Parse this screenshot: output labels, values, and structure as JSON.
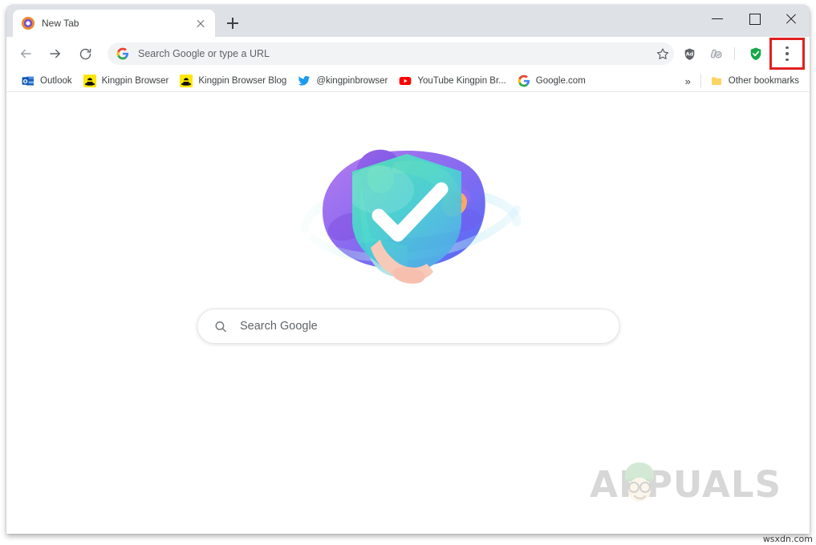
{
  "window": {
    "controls": {
      "minimize": "minimize-button",
      "maximize": "maximize-button",
      "close": "close-button"
    }
  },
  "tabstrip": {
    "tabs": [
      {
        "title": "New Tab",
        "favicon": "kingpin-browser-icon",
        "close_label": "close-tab-icon"
      }
    ],
    "new_tab_label": "+"
  },
  "toolbar": {
    "back_icon": "back-arrow-icon",
    "forward_icon": "forward-arrow-icon",
    "reload_icon": "reload-icon",
    "omnibox": {
      "placeholder": "Search Google or type a URL",
      "value": "",
      "leading_icon": "google-g-icon",
      "star_icon": "bookmark-star-icon"
    },
    "extensions": [
      {
        "name": "adblock-extension-icon"
      },
      {
        "name": "privacy-badger-extension-icon"
      }
    ],
    "shield_icon": "green-shield-check-icon",
    "menu_icon": "three-dot-menu-icon",
    "menu_highlight_color": "#e02020"
  },
  "bookmarks": {
    "items": [
      {
        "label": "Outlook",
        "favicon": "outlook-icon"
      },
      {
        "label": "Kingpin Browser",
        "favicon": "kingpin-hat-icon"
      },
      {
        "label": "Kingpin Browser Blog",
        "favicon": "kingpin-hat-icon"
      },
      {
        "label": "@kingpinbrowser",
        "favicon": "twitter-icon"
      },
      {
        "label": "YouTube Kingpin Br...",
        "favicon": "youtube-icon"
      },
      {
        "label": "Google.com",
        "favicon": "google-g-icon"
      }
    ],
    "overflow_label": "»",
    "other_bookmarks": {
      "label": "Other bookmarks",
      "favicon": "folder-icon"
    }
  },
  "page": {
    "illustration_name": "privacy-shield-illustration",
    "search": {
      "placeholder": "Search Google",
      "value": "",
      "icon": "search-icon"
    },
    "watermark": {
      "text": "APPUALS",
      "face_icon": "appuals-mascot-icon"
    }
  },
  "source_label": "wsxdn.com",
  "colors": {
    "tabstrip_bg": "#dee1e6",
    "toolbar_bg": "#ffffff",
    "omnibox_bg": "#f1f3f4",
    "highlight_red": "#e02020",
    "shield_green": "#17a74a",
    "text_primary": "#3c4043",
    "text_secondary": "#5f6368"
  }
}
